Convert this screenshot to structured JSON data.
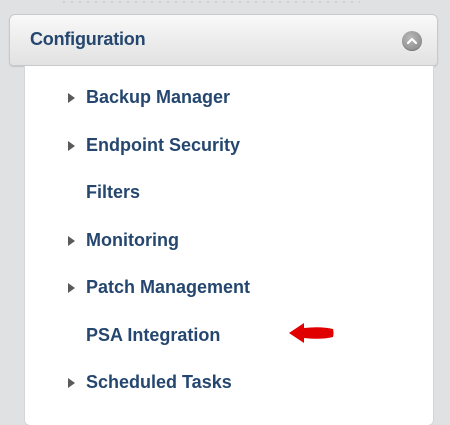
{
  "panel": {
    "title": "Configuration",
    "collapse_icon": "chevron-up-icon"
  },
  "menu": {
    "items": [
      {
        "label": "Backup Manager",
        "expandable": true
      },
      {
        "label": "Endpoint Security",
        "expandable": true
      },
      {
        "label": "Filters",
        "expandable": false
      },
      {
        "label": "Monitoring",
        "expandable": true
      },
      {
        "label": "Patch Management",
        "expandable": true
      },
      {
        "label": "PSA Integration",
        "expandable": false,
        "highlighted": true
      },
      {
        "label": "Scheduled Tasks",
        "expandable": true
      }
    ]
  },
  "colors": {
    "text": "#25476f",
    "arrow": "#5a5a5a",
    "annotation": "#e00000",
    "background": "#dfe1e3"
  }
}
